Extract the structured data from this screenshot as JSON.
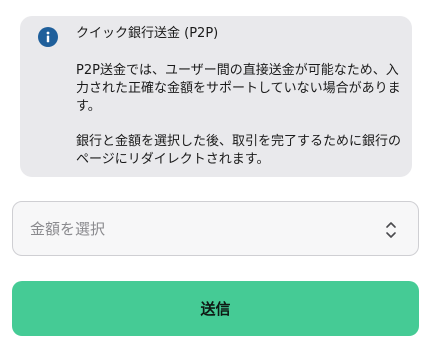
{
  "info": {
    "icon": "info-icon",
    "title": "クイック銀行送金 (P2P)",
    "paragraph1": "P2P送金では、ユーザー間の直接送金が可能なため、入力された正確な金額をサポートしていない場合があります。",
    "paragraph2": "銀行と金額を選択した後、取引を完了するために銀行のページにリダイレクトされます。"
  },
  "amount_select": {
    "placeholder": "金額を選択",
    "icon": "chevron-up-down-icon"
  },
  "submit": {
    "label": "送信"
  },
  "colors": {
    "card_background": "#e9e9ec",
    "info_icon": "#1f5f9b",
    "submit_background": "#45cb95"
  }
}
